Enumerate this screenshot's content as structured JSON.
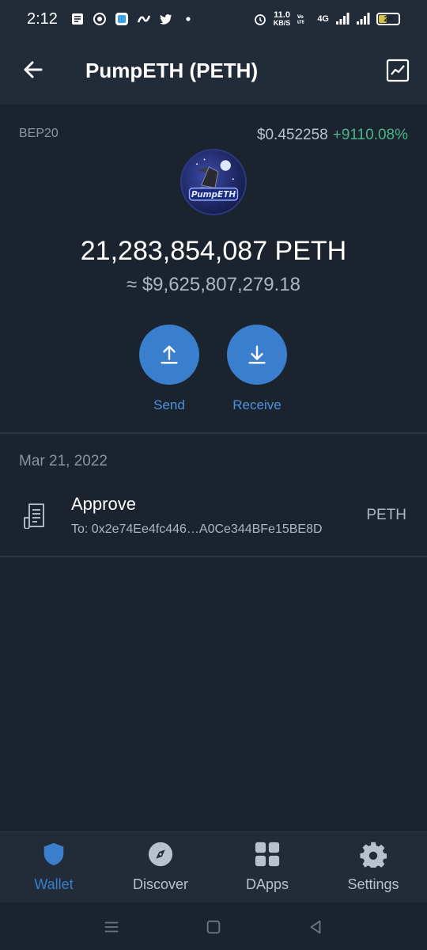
{
  "status_bar": {
    "time": "2:12",
    "net_speed_value": "11.0",
    "net_speed_unit": "KB/S",
    "network_label": "4G",
    "battery_level": "24",
    "icons_left": [
      "notes-icon",
      "app-icon",
      "app-blue-icon",
      "app-swirl-icon",
      "twitter-icon",
      "dot-icon"
    ],
    "icons_right": [
      "alarm-icon",
      "volte-icon",
      "signal-icon",
      "signal-icon-2",
      "battery-icon"
    ]
  },
  "header": {
    "title": "PumpETH (PETH)",
    "back_icon": "back-arrow-icon",
    "chart_icon": "chart-icon"
  },
  "token": {
    "network": "BEP20",
    "price": "$0.452258",
    "change": "+9110.08%",
    "balance": "21,283,854,087 PETH",
    "fiat_balance": "≈ $9,625,807,279.18",
    "logo_text": "PumpETH",
    "colors": {
      "change": "#4ab58c",
      "accent": "#3a7fce"
    }
  },
  "actions": {
    "send_label": "Send",
    "receive_label": "Receive"
  },
  "transactions": {
    "date": "Mar 21, 2022",
    "items": [
      {
        "title": "Approve",
        "to": "To: 0x2e74Ee4fc446…A0Ce344BFe15BE8D",
        "amount": "PETH",
        "icon": "receipt-icon"
      }
    ]
  },
  "bottom_nav": {
    "items": [
      {
        "label": "Wallet",
        "icon": "shield-icon",
        "active": true
      },
      {
        "label": "Discover",
        "icon": "compass-icon",
        "active": false
      },
      {
        "label": "DApps",
        "icon": "grid-icon",
        "active": false
      },
      {
        "label": "Settings",
        "icon": "gear-icon",
        "active": false
      }
    ]
  },
  "system_nav": {
    "icons": [
      "menu-icon",
      "home-icon",
      "back-icon"
    ]
  }
}
